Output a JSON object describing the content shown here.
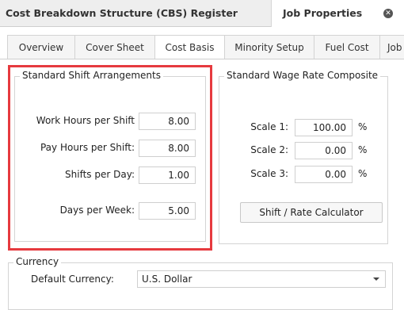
{
  "doc_tabs": {
    "register": "Cost Breakdown Structure (CBS) Register",
    "job_properties": "Job Properties"
  },
  "tabs": [
    "Overview",
    "Cover Sheet",
    "Cost Basis",
    "Minority Setup",
    "Fuel Cost",
    "Job"
  ],
  "active_tab": "Cost Basis",
  "shift": {
    "title": "Standard Shift Arrangements",
    "fields": [
      {
        "label": "Work Hours per Shift",
        "value": "8.00"
      },
      {
        "label": "Pay Hours per Shift:",
        "value": "8.00"
      },
      {
        "label": "Shifts per Day:",
        "value": "1.00"
      },
      {
        "label": "Days per Week:",
        "value": "5.00"
      }
    ]
  },
  "wage": {
    "title": "Standard Wage Rate Composite",
    "scales": [
      {
        "label": "Scale 1:",
        "value": "100.00",
        "unit": "%"
      },
      {
        "label": "Scale 2:",
        "value": "0.00",
        "unit": "%"
      },
      {
        "label": "Scale 3:",
        "value": "0.00",
        "unit": "%"
      }
    ],
    "calculator_button": "Shift / Rate Calculator"
  },
  "currency": {
    "title": "Currency",
    "label": "Default Currency:",
    "value": "U.S. Dollar"
  },
  "icons": {
    "close": "close-circle-icon",
    "dropdown": "chevron-down-icon"
  },
  "colors": {
    "highlight": "#e63a3f"
  }
}
